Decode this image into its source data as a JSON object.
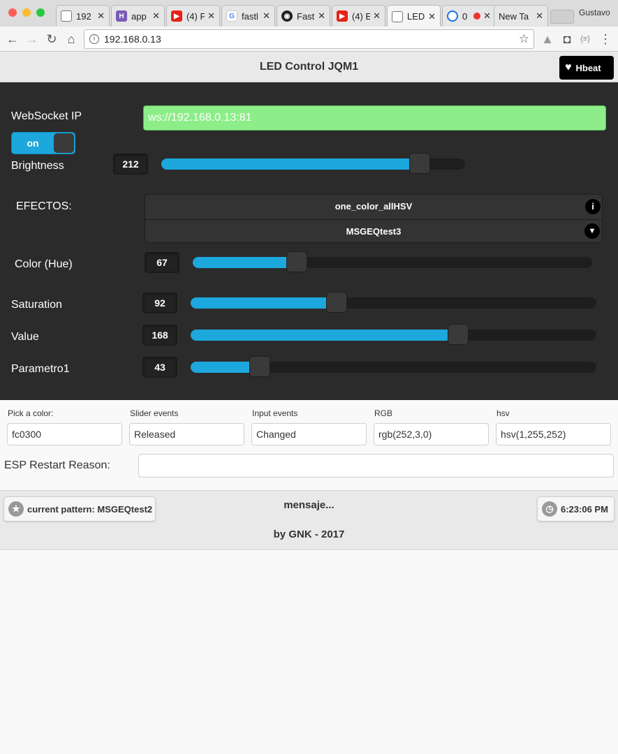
{
  "browser": {
    "tabs": [
      {
        "title": "192",
        "icon": "page-icon"
      },
      {
        "title": "app",
        "icon": "heroku-icon"
      },
      {
        "title": "(4) F",
        "icon": "youtube-icon"
      },
      {
        "title": "fastl",
        "icon": "google-icon"
      },
      {
        "title": "Fast",
        "icon": "github-icon"
      },
      {
        "title": "(4) E",
        "icon": "youtube-icon"
      },
      {
        "title": "LED",
        "icon": "page-icon"
      },
      {
        "title": "0",
        "icon": "chrome-icon"
      },
      {
        "title": "New Ta",
        "icon": ""
      }
    ],
    "profile_name": "Gustavo",
    "url": "192.168.0.13"
  },
  "header": {
    "title": "LED Control JQM1",
    "hbeat_label": "Hbeat"
  },
  "controls": {
    "websocket_label": "WebSocket IP",
    "websocket_value": "ws://192.168.0.13:81",
    "toggle_label": "on",
    "brightness": {
      "label": "Brightness",
      "value": "212",
      "level": 0.85
    },
    "effects_label": "EFECTOS:",
    "effects": [
      "one_color_allHSV",
      "MSGEQtest3"
    ],
    "hue": {
      "label": "Color (Hue)",
      "value": "67",
      "level": 0.26
    },
    "saturation": {
      "label": "Saturation",
      "value": "92",
      "level": 0.36
    },
    "value": {
      "label": "Value",
      "value": "168",
      "level": 0.66
    },
    "param1": {
      "label": "Parametro1",
      "value": "43",
      "level": 0.17
    }
  },
  "form": {
    "fields": [
      {
        "label": "Pick a color:",
        "value": "fc0300"
      },
      {
        "label": "Slider events",
        "value": "Released"
      },
      {
        "label": "Input events",
        "value": "Changed"
      },
      {
        "label": "RGB",
        "value": "rgb(252,3,0)"
      },
      {
        "label": "hsv",
        "value": "hsv(1,255,252)"
      }
    ],
    "restart_label": "ESP Restart Reason:",
    "restart_value": ""
  },
  "footer": {
    "pattern_label": "current pattern: MSGEQtest2",
    "message": "mensaje...",
    "time": "6:23:06 PM",
    "credit": "by GNK - 2017"
  },
  "colors": {
    "accent": "#1ca8dd",
    "ws_bg": "#8ded89",
    "panel": "#2b2b2b"
  }
}
